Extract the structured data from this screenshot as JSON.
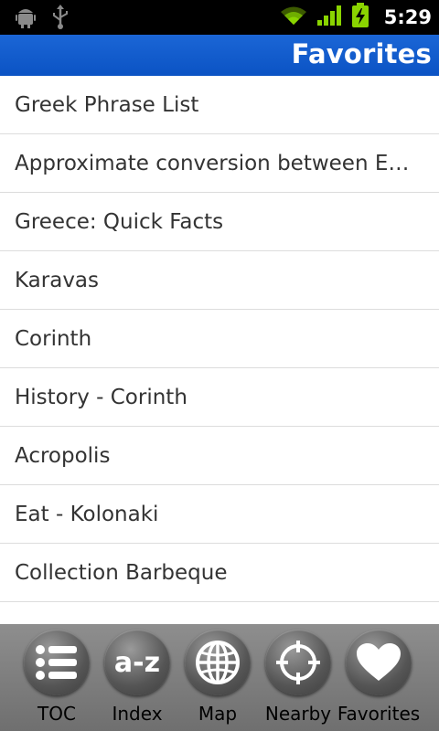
{
  "status_bar": {
    "time": "5:29",
    "icons": [
      "android-debug-icon",
      "usb-icon",
      "wifi-icon",
      "signal-icon",
      "battery-charging-icon"
    ]
  },
  "header": {
    "title": "Favorites"
  },
  "favorites": [
    {
      "label": "Greek Phrase List"
    },
    {
      "label": "Approximate conversion between English"
    },
    {
      "label": "Greece: Quick Facts"
    },
    {
      "label": "Karavas"
    },
    {
      "label": "Corinth"
    },
    {
      "label": "History - Corinth"
    },
    {
      "label": "Acropolis"
    },
    {
      "label": "Eat - Kolonaki"
    },
    {
      "label": "Collection Barbeque"
    }
  ],
  "bottom_nav": [
    {
      "label": "TOC",
      "icon": "list-icon"
    },
    {
      "label": "Index",
      "icon": "a-z-icon"
    },
    {
      "label": "Map",
      "icon": "globe-icon"
    },
    {
      "label": "Nearby",
      "icon": "crosshair-icon"
    },
    {
      "label": "Favorites",
      "icon": "heart-icon"
    }
  ],
  "colors": {
    "title_bar": "#0b53c4",
    "status_bar": "#000000",
    "bottom_bar": "#808080",
    "wifi_green": "#8ad400"
  }
}
